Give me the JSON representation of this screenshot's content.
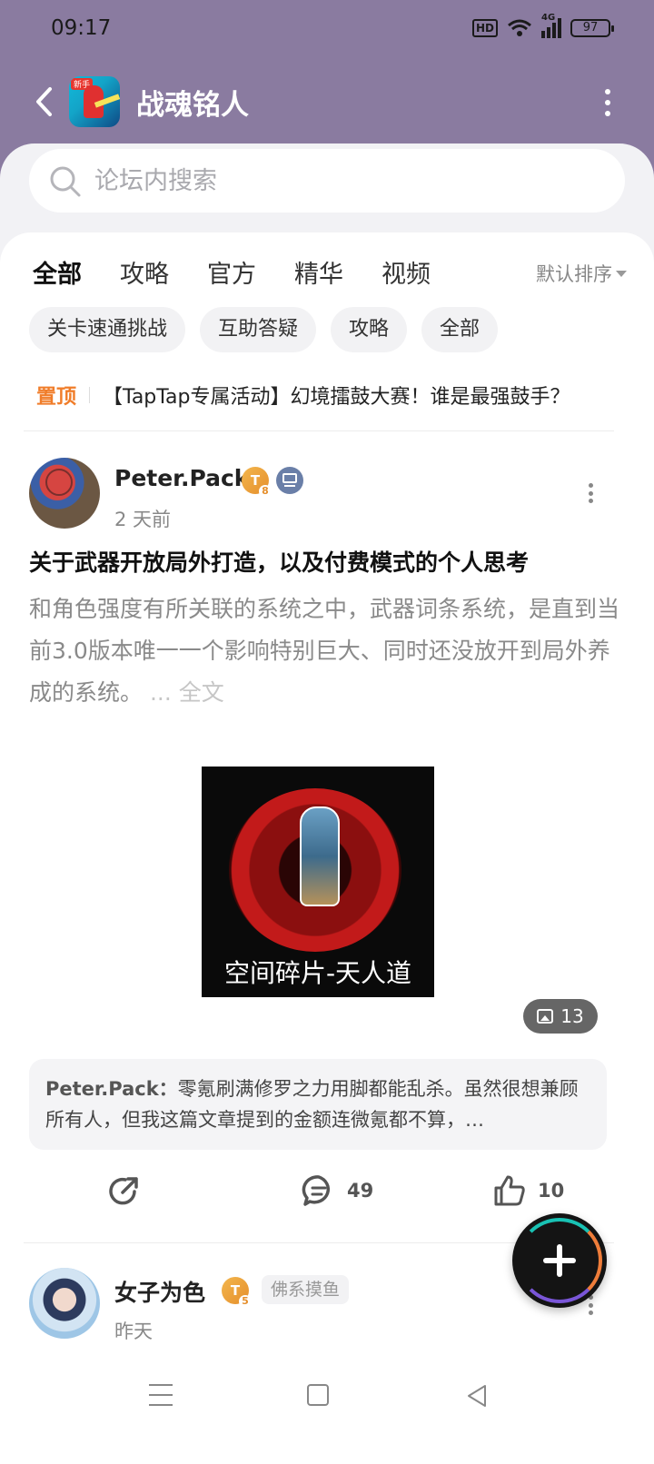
{
  "status_bar": {
    "time": "09:17",
    "hd": "HD",
    "network": "4G",
    "battery": "97"
  },
  "header": {
    "title": "战魂铭人",
    "logo_tag": "新手"
  },
  "search": {
    "placeholder": "论坛内搜索"
  },
  "tabs": {
    "items": [
      "全部",
      "攻略",
      "官方",
      "精华",
      "视频"
    ],
    "active": "全部",
    "sort_label": "默认排序"
  },
  "chips": [
    "关卡速通挑战",
    "互助答疑",
    "攻略",
    "全部"
  ],
  "pinned": {
    "label": "置顶",
    "text": "【TapTap专属活动】幻境擂鼓大赛！谁是最强鼓手？"
  },
  "post1": {
    "author": "Peter.Pack",
    "level": "8",
    "time": "2 天前",
    "title": "关于武器开放局外打造，以及付费模式的个人思考",
    "excerpt": "和角色强度有所关联的系统之中，武器词条系统，是直到当前3.0版本唯一一个影响特别巨大、同时还没放开到局外养成的系统。",
    "ellipsis": "...",
    "full_text_link": "全文",
    "image_caption": "空间碎片-天人道",
    "image_count": "13",
    "comment_preview_author": "Peter.Pack：",
    "comment_preview_text": "零氪刷满修罗之力用脚都能乱杀。虽然很想兼顾所有人，但我这篇文章提到的金额连微氪都不算，…",
    "comments": "49",
    "likes": "10"
  },
  "post2": {
    "author": "女子为色",
    "level": "5",
    "tag": "佛系摸鱼",
    "time": "昨天"
  },
  "colors": {
    "header_bg": "#8a7ba0",
    "accent": "#19c2b4",
    "pinned": "#f07d2a"
  }
}
